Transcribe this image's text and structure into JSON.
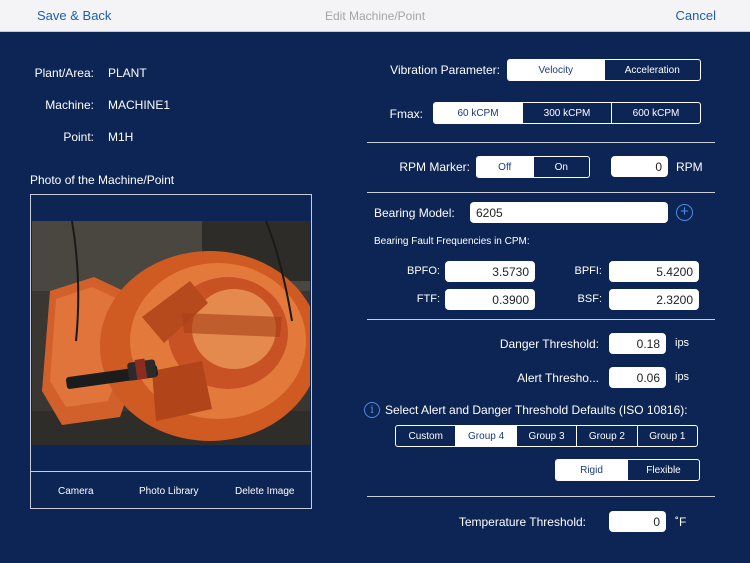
{
  "nav": {
    "save_back": "Save & Back",
    "title": "Edit Machine/Point",
    "cancel": "Cancel"
  },
  "info": {
    "plant_label": "Plant/Area:",
    "plant_value": "PLANT",
    "machine_label": "Machine:",
    "machine_value": "MACHINE1",
    "point_label": "Point:",
    "point_value": "M1H"
  },
  "photo": {
    "heading": "Photo of the Machine/Point",
    "camera": "Camera",
    "library": "Photo Library",
    "delete": "Delete Image"
  },
  "vibration": {
    "label": "Vibration Parameter:",
    "options": [
      "Velocity",
      "Acceleration"
    ],
    "selected": "Velocity"
  },
  "fmax": {
    "label": "Fmax:",
    "options": [
      "60 kCPM",
      "300 kCPM",
      "600 kCPM"
    ],
    "selected": "60 kCPM"
  },
  "rpm": {
    "label": "RPM Marker:",
    "options": [
      "Off",
      "On"
    ],
    "selected": "Off",
    "value": "0",
    "unit": "RPM"
  },
  "bearing": {
    "model_label": "Bearing Model:",
    "model_value": "6205",
    "freq_heading": "Bearing Fault Frequencies in CPM:",
    "bpfo_label": "BPFO:",
    "bpfo": "3.5730",
    "bpfi_label": "BPFI:",
    "bpfi": "5.4200",
    "ftf_label": "FTF:",
    "ftf": "0.3900",
    "bsf_label": "BSF:",
    "bsf": "2.3200"
  },
  "thresholds": {
    "danger_label": "Danger Threshold:",
    "danger": "0.18",
    "danger_unit": "ips",
    "alert_label": "Alert Thresho...",
    "alert": "0.06",
    "alert_unit": "ips",
    "defaults_label": "Select Alert and Danger Threshold Defaults (ISO 10816):",
    "groups": [
      "Custom",
      "Group 4",
      "Group 3",
      "Group 2",
      "Group 1"
    ],
    "group_selected": "Group 4",
    "mounts": [
      "Rigid",
      "Flexible"
    ],
    "mount_selected": "Rigid"
  },
  "temperature": {
    "label": "Temperature Threshold:",
    "value": "0",
    "unit": "˚F"
  },
  "colors": {
    "background": "#0d2554",
    "navbar": "#f4f4f6",
    "accent": "#1a5fb4"
  }
}
